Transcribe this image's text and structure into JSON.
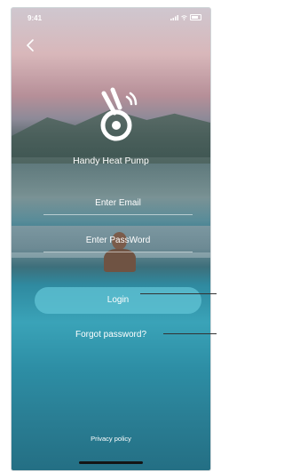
{
  "status_bar": {
    "time": "9:41"
  },
  "app": {
    "name": "Handy Heat Pump"
  },
  "form": {
    "email_placeholder": "Enter Email",
    "password_placeholder": "Enter PassWord",
    "login_label": "Login",
    "forgot_label": "Forgot password?"
  },
  "footer": {
    "privacy_label": "Privacy policy"
  },
  "icons": {
    "back": "chevron-left-icon",
    "logo": "heat-pump-logo-icon",
    "signal": "signal-icon",
    "wifi": "wifi-icon",
    "battery": "battery-icon"
  },
  "colors": {
    "login_button": "#62c4d6",
    "text": "#ffffff"
  }
}
